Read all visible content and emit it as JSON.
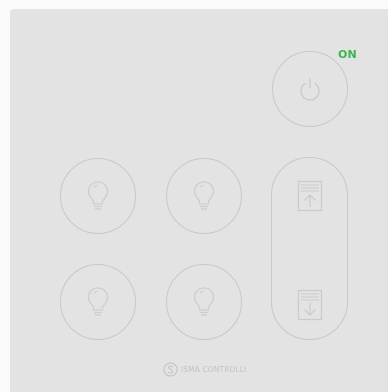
{
  "status": {
    "label": "ON",
    "color": "#3ab54a"
  },
  "power_button": {
    "icon": "power-icon"
  },
  "light_buttons": [
    {
      "icon": "bulb-icon"
    },
    {
      "icon": "bulb-icon"
    },
    {
      "icon": "bulb-icon"
    },
    {
      "icon": "bulb-icon"
    }
  ],
  "blind_rocker": {
    "up_icon": "blind-up-icon",
    "down_icon": "blind-down-icon"
  },
  "brand": {
    "name": "ISMA CONTROLLI",
    "icon": "isma-logo-icon"
  },
  "colors": {
    "panel": "#e3e3e3",
    "outline": "#c8c8c8",
    "logo": "#c2c2c2"
  }
}
